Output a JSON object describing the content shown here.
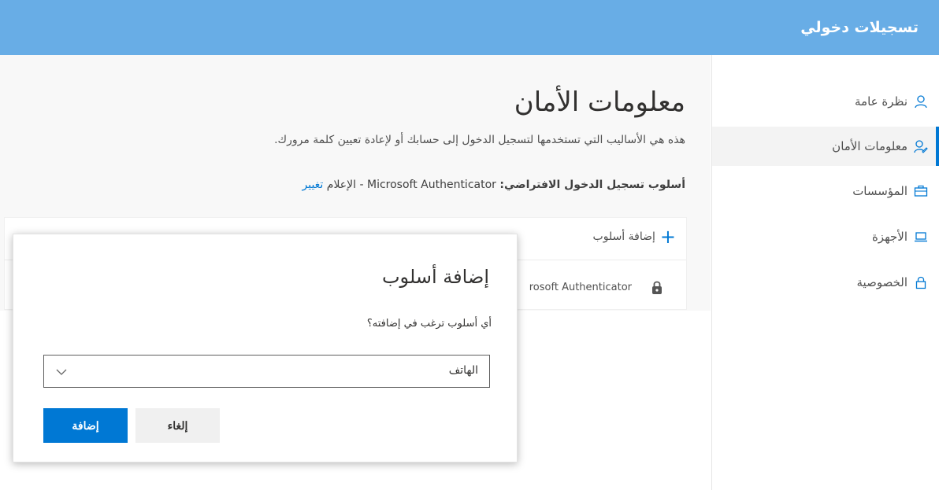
{
  "header": {
    "title": "تسجيلات دخولي",
    "bg_color": "#68ade6"
  },
  "sidebar": {
    "items": [
      {
        "label": "نظرة عامة",
        "icon": "person-icon",
        "active": false
      },
      {
        "label": "معلومات الأمان",
        "icon": "security-info-icon",
        "active": true
      },
      {
        "label": "المؤسسات",
        "icon": "briefcase-icon",
        "active": false
      },
      {
        "label": "الأجهزة",
        "icon": "laptop-icon",
        "active": false
      },
      {
        "label": "الخصوصية",
        "icon": "lock-icon",
        "active": false
      }
    ],
    "active_color": "#0078d4"
  },
  "main": {
    "title": "معلومات الأمان",
    "subtitle": "هذه هي الأساليب التي تستخدمها لتسجيل الدخول إلى حسابك أو لإعادة تعيين كلمة مرورك.",
    "default_method": {
      "label": "أسلوب تسجيل الدخول الافتراضي:",
      "value": "Microsoft Authenticator - الإعلام",
      "change_link": "تغيير"
    },
    "add_method_label": "إضافة أسلوب",
    "methods": [
      {
        "name": "Microsoft Authenticator",
        "visible_text": "rosoft Authenticator",
        "icon": "authenticator-lock-icon"
      }
    ]
  },
  "dialog": {
    "title": "إضافة أسلوب",
    "question": "أي أسلوب ترغب في إضافته؟",
    "select": {
      "selected_value": "الهاتف",
      "icon": "chevron-down-icon"
    },
    "buttons": {
      "cancel_label": "إلغاء",
      "add_label": "إضافة"
    },
    "primary_color": "#0078d4"
  }
}
